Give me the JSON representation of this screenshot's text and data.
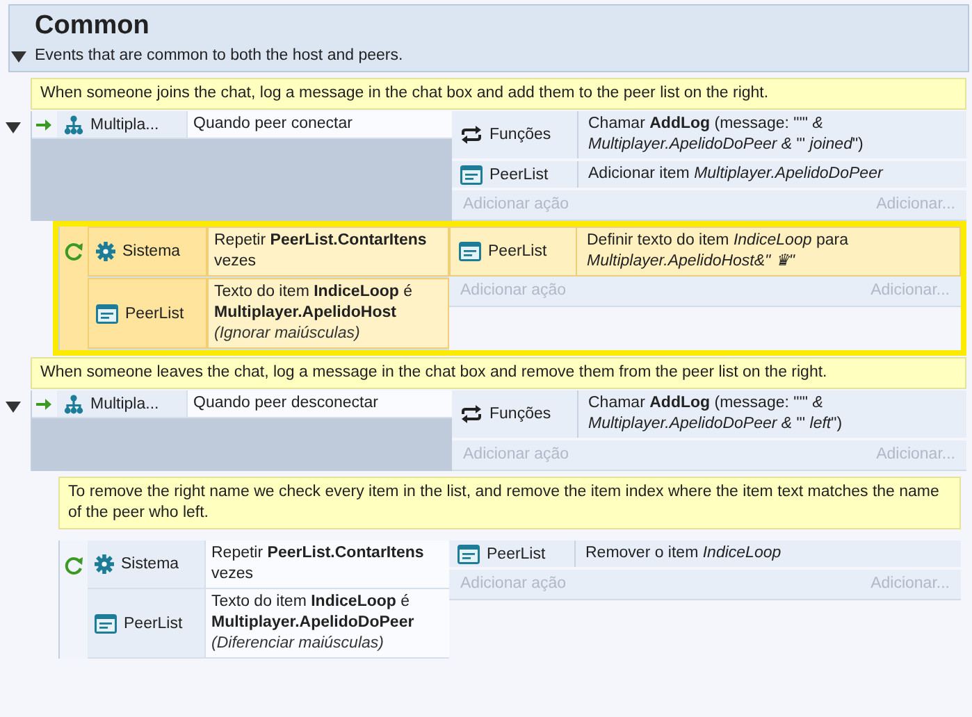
{
  "group": {
    "title": "Common",
    "description": "Events that are common to both the host and peers.",
    "expanded": true
  },
  "events": [
    {
      "kind": "comment",
      "selected": false,
      "text": "When someone joins the chat, log a message in the chat box and add them to the peer list on the right."
    },
    {
      "kind": "standard",
      "selected": false,
      "expanded": true,
      "conditions": [
        {
          "trigger": true,
          "kind": "multiplayer",
          "object": "Multipla...",
          "text": "Quando peer conectar"
        }
      ],
      "actions": [
        {
          "kind": "functions",
          "object": "Funções",
          "text": "Chamar **AddLog** (message: \"'\" *& Multiplayer.ApelidoDoPeer &* \"' *joined*\")"
        },
        {
          "kind": "object",
          "object": "PeerList",
          "text": "Adicionar item *Multiplayer.ApelidoDoPeer*"
        }
      ],
      "add_action": "Adicionar ação",
      "add_other": "Adicionar...",
      "children": [
        {
          "kind": "repeat",
          "selected": true,
          "conditions": [
            {
              "kind": "system",
              "object": "Sistema",
              "text": "Repetir **PeerList.ContarItens** vezes"
            },
            {
              "kind": "object",
              "object": "PeerList",
              "text": "Texto do item **IndiceLoop** é **Multiplayer.ApelidoHost**",
              "note": "(Ignorar maiúsculas)"
            }
          ],
          "actions": [
            {
              "kind": "object",
              "object": "PeerList",
              "text": "Definir texto do item *IndiceLoop* para *Multiplayer.ApelidoHost&\" ♛\"*"
            }
          ],
          "add_action": "Adicionar ação",
          "add_other": "Adicionar..."
        }
      ]
    },
    {
      "kind": "comment",
      "selected": false,
      "text": "When someone leaves the chat, log a message in the chat box and remove them from the peer list on the right."
    },
    {
      "kind": "standard",
      "selected": false,
      "expanded": true,
      "conditions": [
        {
          "trigger": true,
          "kind": "multiplayer",
          "object": "Multipla...",
          "text": "Quando peer desconectar"
        }
      ],
      "actions": [
        {
          "kind": "functions",
          "object": "Funções",
          "text": "Chamar **AddLog** (message: \"'\" *& Multiplayer.ApelidoDoPeer &* \"' *left*\")"
        }
      ],
      "add_action": "Adicionar ação",
      "add_other": "Adicionar...",
      "children": [
        {
          "kind": "comment",
          "selected": false,
          "text": "To remove the right name we check every item in the list, and remove the item index where the item text matches the name of the peer who left."
        },
        {
          "kind": "repeat",
          "selected": false,
          "conditions": [
            {
              "kind": "system",
              "object": "Sistema",
              "text": "Repetir **PeerList.ContarItens** vezes"
            },
            {
              "kind": "object",
              "object": "PeerList",
              "text": "Texto do item **IndiceLoop** é **Multiplayer.ApelidoDoPeer**",
              "note": "(Diferenciar maiúsculas)"
            }
          ],
          "actions": [
            {
              "kind": "object",
              "object": "PeerList",
              "text": "Remover o item *IndiceLoop*"
            }
          ],
          "add_action": "Adicionar ação",
          "add_other": "Adicionar..."
        }
      ]
    }
  ]
}
